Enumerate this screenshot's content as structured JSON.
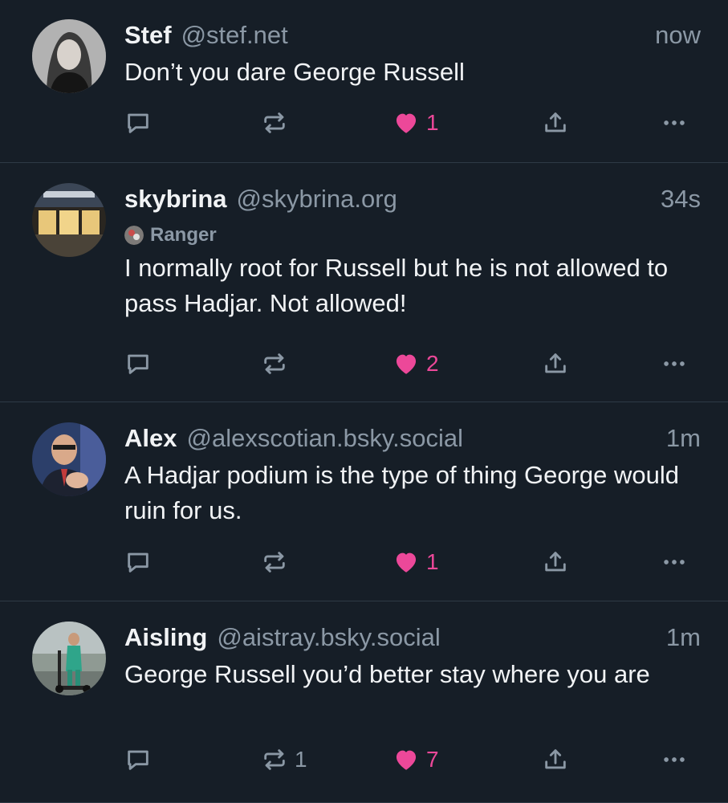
{
  "posts": [
    {
      "name": "Stef",
      "handle": "@stef.net",
      "time": "now",
      "text": "Don’t you dare George Russell",
      "avatar_icon": "portrait-woman-bw",
      "reply_count": "",
      "repost_count": "",
      "like_count": "1",
      "liked": true
    },
    {
      "name": "skybrina",
      "handle": "@skybrina.org",
      "time": "34s",
      "label": "Ranger",
      "label_icon": "ranger-badge-icon",
      "text": "I normally root for Russell but he is not allowed to pass Hadjar. Not allowed!",
      "avatar_icon": "storefront-photo",
      "reply_count": "",
      "repost_count": "",
      "like_count": "2",
      "liked": true
    },
    {
      "name": "Alex",
      "handle": "@alexscotian.bsky.social",
      "time": "1m",
      "text": "A Hadjar podium is the type of thing George would ruin for us.",
      "avatar_icon": "man-with-glasses-photo",
      "reply_count": "",
      "repost_count": "",
      "like_count": "1",
      "liked": true
    },
    {
      "name": "Aisling",
      "handle": "@aistray.bsky.social",
      "time": "1m",
      "text": "George Russell you’d better stay where you are",
      "avatar_icon": "person-on-scooter-photo",
      "reply_count": "",
      "repost_count": "1",
      "like_count": "7",
      "liked": true
    }
  ],
  "colors": {
    "background": "#161e27",
    "divider": "#2e3a46",
    "text_primary": "#f1f3f5",
    "text_secondary": "#8b98a5",
    "like": "#ec4899"
  }
}
